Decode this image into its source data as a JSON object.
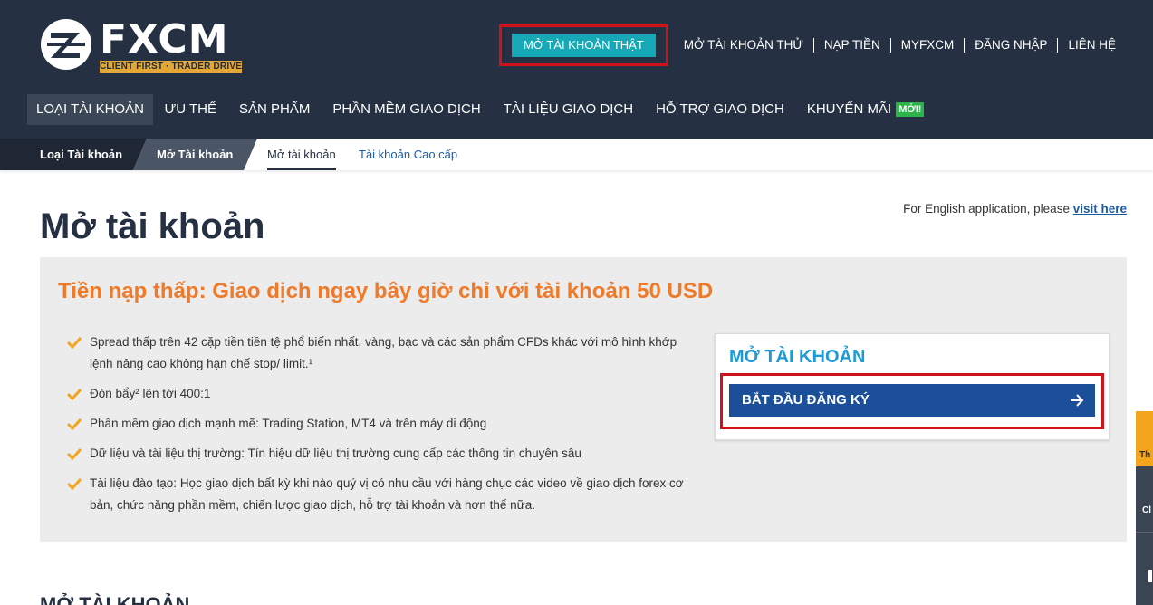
{
  "header": {
    "logo": {
      "wordmark": "FXCM",
      "tagline": "CLIENT FIRST · TRADER DRIVEN",
      "colors": {
        "tagline_bg": "#e3a736",
        "mark": "#ffffff"
      }
    },
    "top_nav": {
      "open_real": "MỞ TÀI KHOẢN THẬT",
      "links": [
        "MỞ TÀI KHOẢN THỬ",
        "NẠP TIỀN",
        "MYFXCM",
        "ĐĂNG NHẬP",
        "LIÊN HỆ"
      ]
    },
    "main_nav": {
      "items": [
        "LOẠI TÀI KHOẢN",
        "ƯU THẾ",
        "SẢN PHẨM",
        "PHẦN MỀM GIAO DỊCH",
        "TÀI LIỆU GIAO DỊCH",
        "HỖ TRỢ GIAO DỊCH",
        "KHUYẾN MÃI"
      ],
      "active": "LOẠI TÀI KHOẢN",
      "new_badge": "MỚI!"
    },
    "colors": {
      "bg": "#253142",
      "accent_teal": "#16a9b5",
      "highlight_red": "#d0121b",
      "badge_green": "#2db34a"
    }
  },
  "breadcrumb": {
    "items": [
      "Loại Tài khoản",
      "Mở Tài khoản"
    ],
    "sub_tabs": [
      "Mở tài khoản",
      "Tài khoản Cao cấp"
    ],
    "active_sub_tab": "Mở tài khoản"
  },
  "main": {
    "title": "Mở tài khoản",
    "english_note": "For English application, please",
    "english_link": "visit here",
    "panel": {
      "heading": "Tiền nạp thấp: Giao dịch ngay bây giờ chỉ với tài khoản 50 USD",
      "bullets": [
        "Spread thấp trên 42 cặp tiền tiền tệ phổ biến nhất, vàng, bạc và các sản phẩm CFDs khác với mô hình khớp lệnh nâng cao không hạn chế stop/ limit.¹",
        "Đòn bẩy² lên tới 400:1",
        "Phần mềm giao dịch mạnh mẽ: Trading Station, MT4 và trên máy di động",
        "Dữ liệu và tài liệu thị trường: Tín hiệu dữ liệu thị trường cung cấp các thông tin chuyên sâu",
        "Tài liệu đào tạo: Học giao dịch bất kỳ khi nào quý vị có nhu cầu với hàng chục các video về giao dịch forex cơ bản, chức năng phần mềm, chiến lược giao dịch, hỗ trợ tài khoản và hơn thế nữa."
      ],
      "bullet_icon": "check-icon",
      "colors": {
        "heading": "#ef7a2a",
        "check": "#f2a51d",
        "bg": "#ececec"
      }
    },
    "signup": {
      "title": "MỞ TÀI KHOẢN",
      "button": "BẮT ĐẦU ĐĂNG KÝ",
      "button_icon": "arrow-right-icon",
      "colors": {
        "title": "#1c9ad6",
        "button": "#1c4f99"
      }
    },
    "next_section_heading": "MỞ TÀI KHOẢN"
  },
  "side_widgets": {
    "orange_tab": "Th",
    "dark_tab": "Cl"
  }
}
